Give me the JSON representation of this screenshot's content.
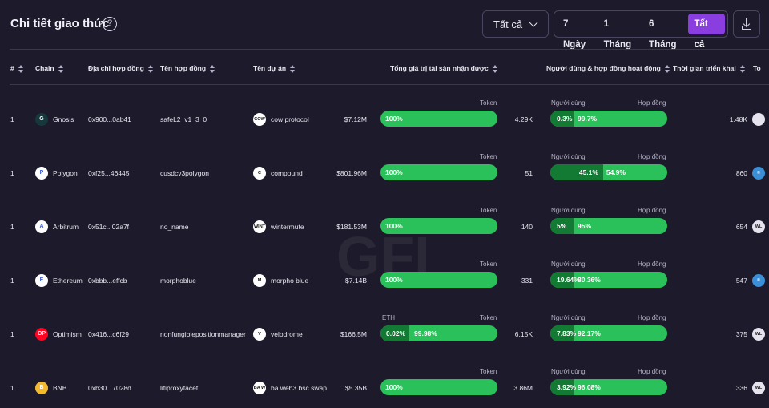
{
  "header": {
    "title": "Chi tiết giao thức",
    "help": "?",
    "filter_value": "Tất cả",
    "ranges": [
      "7 Ngày",
      "1 Tháng",
      "6 Tháng",
      "Tất cả"
    ],
    "active_range": "Tất cả"
  },
  "columns": [
    "#",
    "Chain",
    "Địa chỉ hợp đồng",
    "Tên hợp đồng",
    "Tên dự án",
    "Tổng giá trị tài sản nhận được",
    "Người dùng & hợp đồng hoạt động",
    "Thời gian triển khai",
    "To"
  ],
  "labels": {
    "token": "Token",
    "users": "Người dùng",
    "contracts": "Hợp đồng"
  },
  "rows": [
    {
      "rank": "1",
      "chain": "Gnosis",
      "chain_color": "#16383c",
      "chain_abbr": "G",
      "address": "0x900...0ab41",
      "contract": "safeL2_v1_3_0",
      "project": "cow protocol",
      "project_abbr": "COW",
      "tvl": "$7.12M",
      "asset_left": "",
      "asset_pct1": "",
      "asset_pct2": "100%",
      "asset_fill": 0,
      "count": "4.29K",
      "user_pct": "0.3%",
      "contract_pct": "99.7%",
      "user_fill": 0.003,
      "deploy": "1.48K",
      "avatar": ""
    },
    {
      "rank": "1",
      "chain": "Polygon",
      "chain_color": "#ffffff",
      "chain_abbr": "P",
      "address": "0xf25...46445",
      "contract": "cusdcv3polygon",
      "project": "compound",
      "project_abbr": "C",
      "tvl": "$801.96M",
      "asset_left": "",
      "asset_pct1": "",
      "asset_pct2": "100%",
      "asset_fill": 0,
      "count": "51",
      "user_pct": "45.1%",
      "contract_pct": "54.9%",
      "user_fill": 0.451,
      "deploy": "860",
      "avatar": "©"
    },
    {
      "rank": "1",
      "chain": "Arbitrum",
      "chain_color": "#ffffff",
      "chain_abbr": "A",
      "address": "0x51c...02a7f",
      "contract": "no_name",
      "project": "wintermute",
      "project_abbr": "WINT",
      "tvl": "$181.53M",
      "asset_left": "",
      "asset_pct1": "",
      "asset_pct2": "100%",
      "asset_fill": 0,
      "count": "140",
      "user_pct": "5%",
      "contract_pct": "95%",
      "user_fill": 0.05,
      "deploy": "654",
      "avatar": "WL"
    },
    {
      "rank": "1",
      "chain": "Ethereum",
      "chain_color": "#ffffff",
      "chain_abbr": "E",
      "address": "0xbbb...effcb",
      "contract": "morphoblue",
      "project": "morpho blue",
      "project_abbr": "M",
      "tvl": "$7.14B",
      "asset_left": "",
      "asset_pct1": "",
      "asset_pct2": "100%",
      "asset_fill": 0,
      "count": "331",
      "user_pct": "19.64%",
      "contract_pct": "80.36%",
      "user_fill": 0.1964,
      "deploy": "547",
      "avatar": "©"
    },
    {
      "rank": "1",
      "chain": "Optimism",
      "chain_color": "#ff0420",
      "chain_abbr": "OP",
      "address": "0x416...c6f29",
      "contract": "nonfungiblepositionmanager",
      "project": "velodrome",
      "project_abbr": "V",
      "tvl": "$166.5M",
      "asset_left": "ETH",
      "asset_pct1": "0.02%",
      "asset_pct2": "99.98%",
      "asset_fill": 0.0002,
      "count": "6.15K",
      "user_pct": "7.83%",
      "contract_pct": "92.17%",
      "user_fill": 0.0783,
      "deploy": "375",
      "avatar": "WL"
    },
    {
      "rank": "1",
      "chain": "BNB",
      "chain_color": "#f3ba2f",
      "chain_abbr": "B",
      "address": "0xb30...7028d",
      "contract": "lifiproxyfacet",
      "project": "ba web3 bsc swap",
      "project_abbr": "BA W",
      "tvl": "$5.35B",
      "asset_left": "",
      "asset_pct1": "",
      "asset_pct2": "100%",
      "asset_fill": 0,
      "count": "3.86M",
      "user_pct": "3.92%",
      "contract_pct": "96.08%",
      "user_fill": 0.0392,
      "deploy": "336",
      "avatar": "WL"
    }
  ]
}
